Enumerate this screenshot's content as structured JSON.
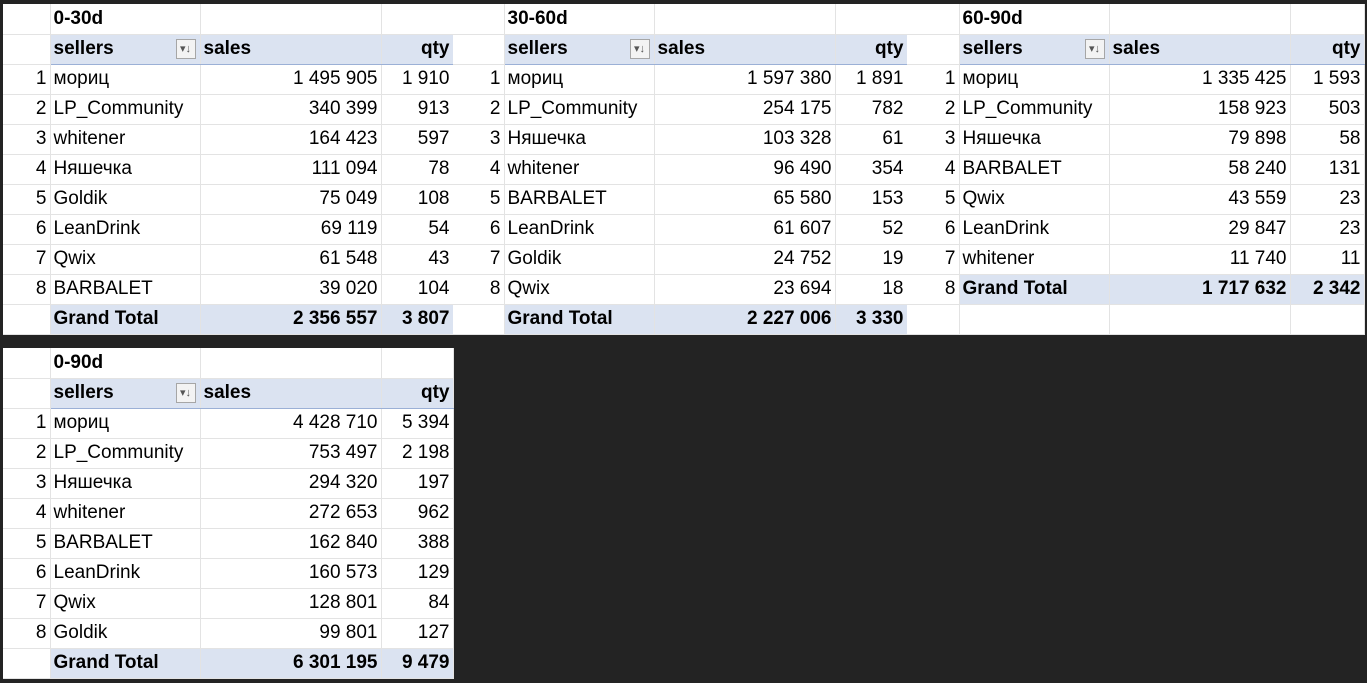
{
  "pivots": [
    {
      "period": "0-30d",
      "headers": {
        "sellers": "sellers",
        "sales": "sales",
        "qty": "qty"
      },
      "rows": [
        {
          "n": "1",
          "seller": "мориц",
          "sales": "1 495 905",
          "qty": "1 910"
        },
        {
          "n": "2",
          "seller": "LP_Community",
          "sales": "340 399",
          "qty": "913"
        },
        {
          "n": "3",
          "seller": "whitener",
          "sales": "164 423",
          "qty": "597"
        },
        {
          "n": "4",
          "seller": "Няшечка",
          "sales": "111 094",
          "qty": "78"
        },
        {
          "n": "5",
          "seller": "Goldik",
          "sales": "75 049",
          "qty": "108"
        },
        {
          "n": "6",
          "seller": "LeanDrink",
          "sales": "69 119",
          "qty": "54"
        },
        {
          "n": "7",
          "seller": "Qwix",
          "sales": "61 548",
          "qty": "43"
        },
        {
          "n": "8",
          "seller": "BARBALET",
          "sales": "39 020",
          "qty": "104"
        }
      ],
      "total": {
        "label": "Grand Total",
        "sales": "2 356 557",
        "qty": "3 807"
      }
    },
    {
      "period": "30-60d",
      "headers": {
        "sellers": "sellers",
        "sales": "sales",
        "qty": "qty"
      },
      "rows": [
        {
          "n": "1",
          "seller": "мориц",
          "sales": "1 597 380",
          "qty": "1 891"
        },
        {
          "n": "2",
          "seller": "LP_Community",
          "sales": "254 175",
          "qty": "782"
        },
        {
          "n": "3",
          "seller": "Няшечка",
          "sales": "103 328",
          "qty": "61"
        },
        {
          "n": "4",
          "seller": "whitener",
          "sales": "96 490",
          "qty": "354"
        },
        {
          "n": "5",
          "seller": "BARBALET",
          "sales": "65 580",
          "qty": "153"
        },
        {
          "n": "6",
          "seller": "LeanDrink",
          "sales": "61 607",
          "qty": "52"
        },
        {
          "n": "7",
          "seller": "Goldik",
          "sales": "24 752",
          "qty": "19"
        },
        {
          "n": "8",
          "seller": "Qwix",
          "sales": "23 694",
          "qty": "18"
        }
      ],
      "total": {
        "label": "Grand Total",
        "sales": "2 227 006",
        "qty": "3 330"
      }
    },
    {
      "period": "60-90d",
      "headers": {
        "sellers": "sellers",
        "sales": "sales",
        "qty": "qty"
      },
      "rows": [
        {
          "n": "1",
          "seller": "мориц",
          "sales": "1 335 425",
          "qty": "1 593"
        },
        {
          "n": "2",
          "seller": "LP_Community",
          "sales": "158 923",
          "qty": "503"
        },
        {
          "n": "3",
          "seller": "Няшечка",
          "sales": "79 898",
          "qty": "58"
        },
        {
          "n": "4",
          "seller": "BARBALET",
          "sales": "58 240",
          "qty": "131"
        },
        {
          "n": "5",
          "seller": "Qwix",
          "sales": "43 559",
          "qty": "23"
        },
        {
          "n": "6",
          "seller": "LeanDrink",
          "sales": "29 847",
          "qty": "23"
        },
        {
          "n": "7",
          "seller": "whitener",
          "sales": "11 740",
          "qty": "11"
        }
      ],
      "total": {
        "n": "8",
        "label": "Grand Total",
        "sales": "1 717 632",
        "qty": "2 342"
      }
    },
    {
      "period": "0-90d",
      "headers": {
        "sellers": "sellers",
        "sales": "sales",
        "qty": "qty"
      },
      "rows": [
        {
          "n": "1",
          "seller": "мориц",
          "sales": "4 428 710",
          "qty": "5 394"
        },
        {
          "n": "2",
          "seller": "LP_Community",
          "sales": "753 497",
          "qty": "2 198"
        },
        {
          "n": "3",
          "seller": "Няшечка",
          "sales": "294 320",
          "qty": "197"
        },
        {
          "n": "4",
          "seller": "whitener",
          "sales": "272 653",
          "qty": "962"
        },
        {
          "n": "5",
          "seller": "BARBALET",
          "sales": "162 840",
          "qty": "388"
        },
        {
          "n": "6",
          "seller": "LeanDrink",
          "sales": "160 573",
          "qty": "129"
        },
        {
          "n": "7",
          "seller": "Qwix",
          "sales": "128 801",
          "qty": "84"
        },
        {
          "n": "8",
          "seller": "Goldik",
          "sales": "99 801",
          "qty": "127"
        }
      ],
      "total": {
        "label": "Grand Total",
        "sales": "6 301 195",
        "qty": "9 479"
      }
    }
  ],
  "icons": {
    "filter": "sort-filter-icon"
  },
  "colors": {
    "header_band": "#dbe3f1",
    "background": "#232323",
    "cell": "#ffffff"
  }
}
